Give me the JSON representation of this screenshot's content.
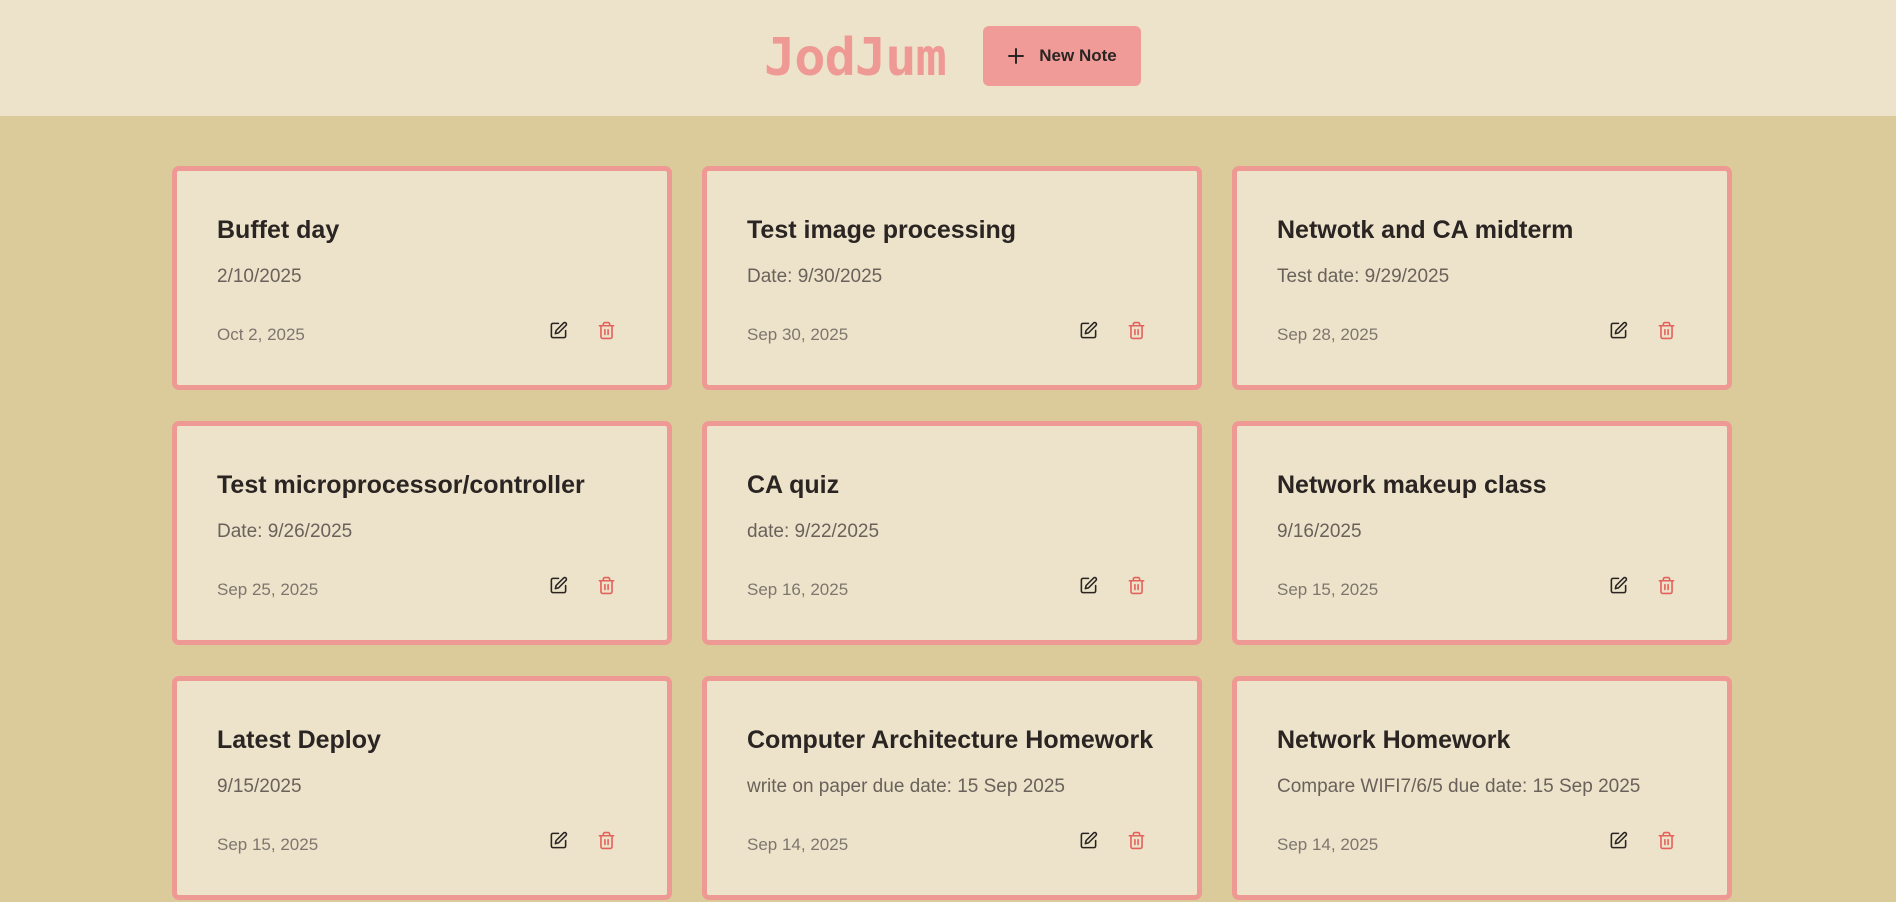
{
  "header": {
    "brand": "JodJum",
    "new_note_label": "New Note",
    "new_note_icon": "plus-icon"
  },
  "colors": {
    "accent": "#ef9994",
    "header_bg": "#ede3cb",
    "page_bg": "#dbcb9a",
    "card_bg": "#ede3cb",
    "delete_icon": "#e4605a"
  },
  "notes": [
    {
      "title": "Buffet day",
      "content": "2/10/2025",
      "date": "Oct 2, 2025"
    },
    {
      "title": "Test image processing",
      "content": "Date: 9/30/2025",
      "date": "Sep 30, 2025"
    },
    {
      "title": "Netwotk and CA midterm",
      "content": "Test date: 9/29/2025",
      "date": "Sep 28, 2025"
    },
    {
      "title": "Test microprocessor/controller",
      "content": "Date: 9/26/2025",
      "date": "Sep 25, 2025"
    },
    {
      "title": "CA quiz",
      "content": "date: 9/22/2025",
      "date": "Sep 16, 2025"
    },
    {
      "title": "Network makeup class",
      "content": "9/16/2025",
      "date": "Sep 15, 2025"
    },
    {
      "title": "Latest Deploy",
      "content": "9/15/2025",
      "date": "Sep 15, 2025"
    },
    {
      "title": "Computer Architecture Homework",
      "content": "write on paper due date: 15 Sep 2025",
      "date": "Sep 14, 2025"
    },
    {
      "title": "Network Homework",
      "content": "Compare WIFI7/6/5 due date: 15 Sep 2025",
      "date": "Sep 14, 2025"
    }
  ],
  "card_icons": {
    "edit": "edit-icon",
    "delete": "trash-icon"
  }
}
